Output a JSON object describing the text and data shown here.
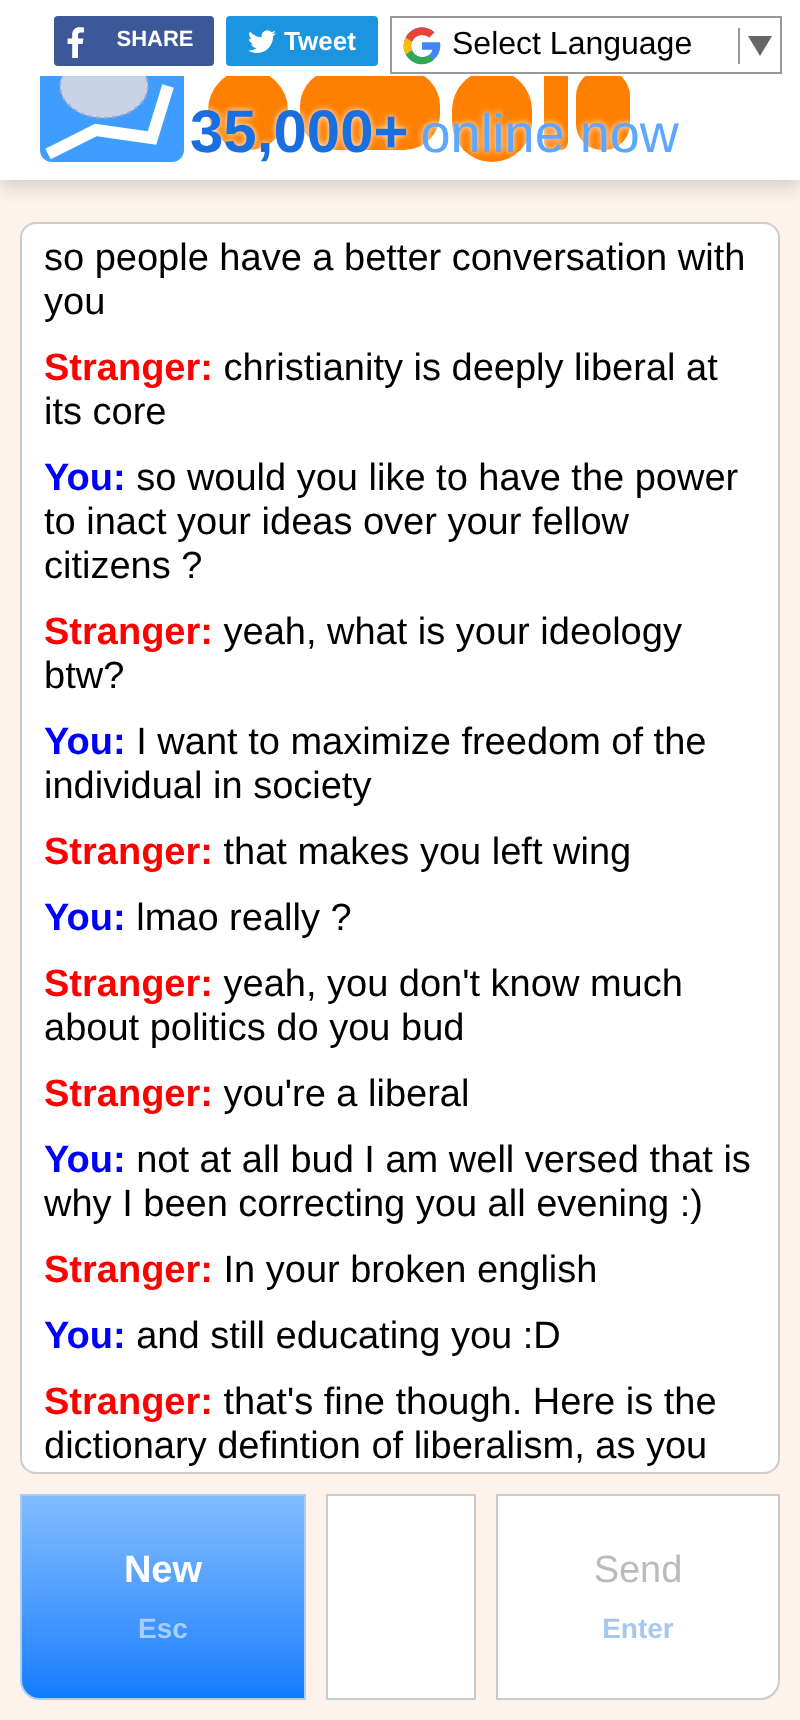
{
  "header": {
    "share_label": "SHARE",
    "tweet_label": "Tweet",
    "language_select": "Select Language",
    "online_count": "35,000+",
    "online_label": "online now"
  },
  "messages": [
    {
      "kind": "continuation",
      "text": "so people have a better conversation with you"
    },
    {
      "kind": "stranger",
      "speaker": "Stranger:",
      "text": "christianity is deeply liberal at its core"
    },
    {
      "kind": "you",
      "speaker": "You:",
      "text": "so would you like to have the power to inact your ideas over your fellow citizens ?"
    },
    {
      "kind": "stranger",
      "speaker": "Stranger:",
      "text": "yeah, what is your ideology btw?"
    },
    {
      "kind": "you",
      "speaker": "You:",
      "text": "I want to maximize freedom of the individual in society"
    },
    {
      "kind": "stranger",
      "speaker": "Stranger:",
      "text": "that makes you left wing"
    },
    {
      "kind": "you",
      "speaker": "You:",
      "text": "lmao really ?"
    },
    {
      "kind": "stranger",
      "speaker": "Stranger:",
      "text": "yeah, you don't know much about politics do you bud"
    },
    {
      "kind": "stranger",
      "speaker": "Stranger:",
      "text": "you're a liberal"
    },
    {
      "kind": "you",
      "speaker": "You:",
      "text": "not at all bud I am well versed that is why I been correcting you all evening :)"
    },
    {
      "kind": "stranger",
      "speaker": "Stranger:",
      "text": "In your broken english"
    },
    {
      "kind": "you",
      "speaker": "You:",
      "text": "and still educating you :D"
    },
    {
      "kind": "stranger",
      "speaker": "Stranger:",
      "text": "that's fine though. Here is the dictionary defintion of liberalism, as you"
    }
  ],
  "controls": {
    "new_label": "New",
    "new_key": "Esc",
    "send_label": "Send",
    "send_key": "Enter",
    "send_disabled": true
  }
}
